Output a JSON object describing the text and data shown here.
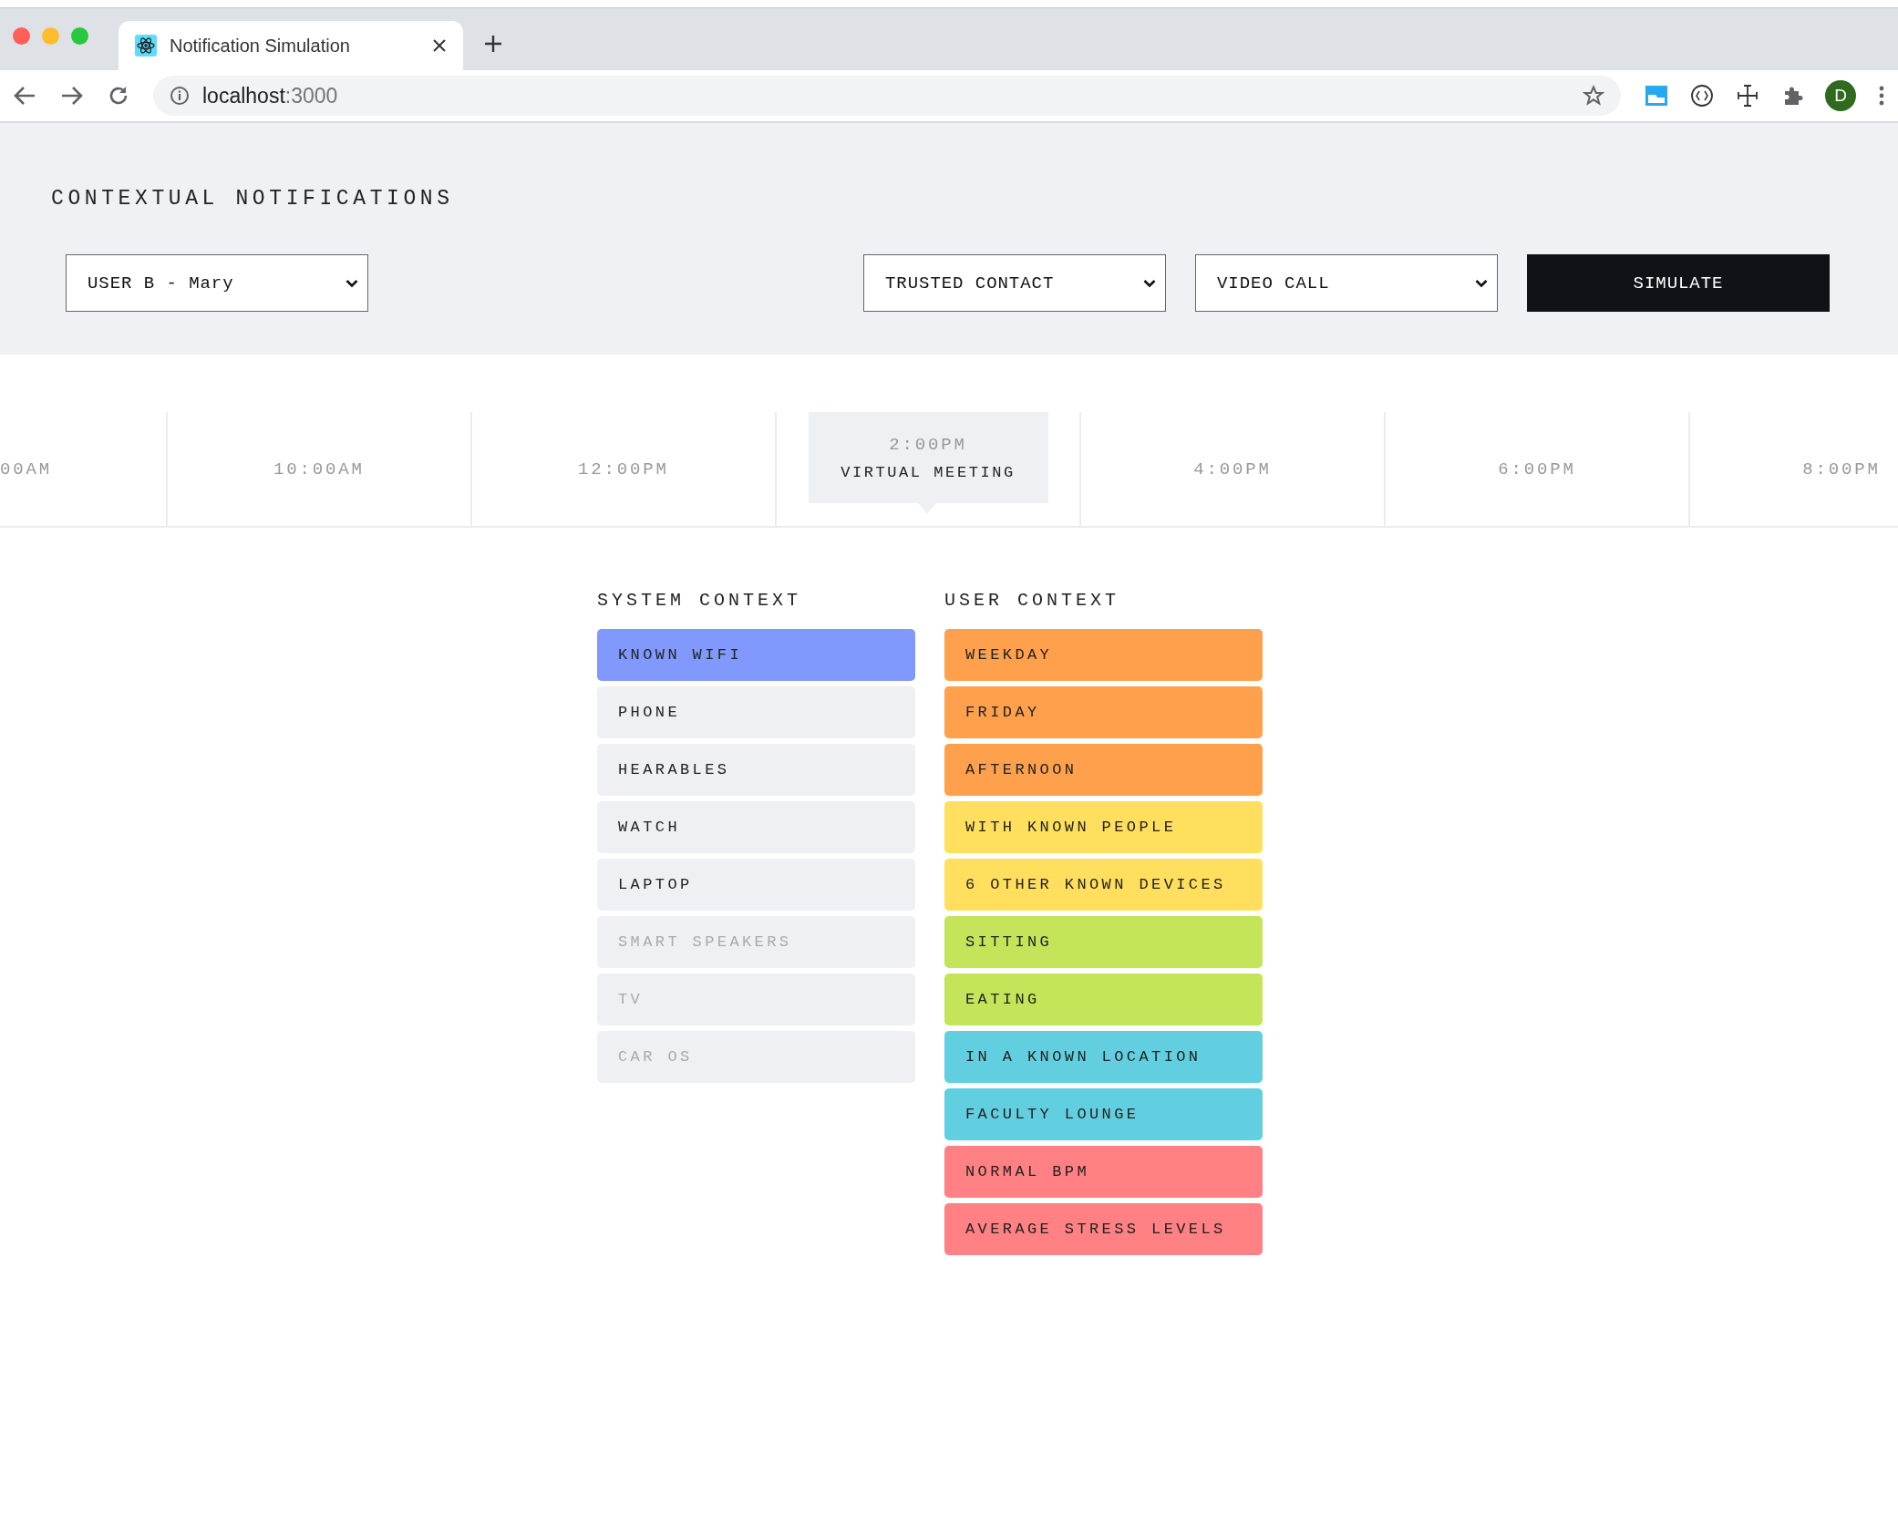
{
  "browser": {
    "tab": {
      "title": "Notification Simulation"
    },
    "url": {
      "host": "localhost",
      "port": ":3000"
    },
    "profile": "D"
  },
  "page": {
    "title": "CONTEXTUAL NOTIFICATIONS",
    "user_select": "USER B - Mary",
    "contact_select": "TRUSTED CONTACT",
    "event_select": "VIDEO CALL",
    "simulate": "SIMULATE",
    "timeline": [
      {
        "time": "00AM",
        "selected": false
      },
      {
        "time": "10:00AM",
        "selected": false
      },
      {
        "time": "12:00PM",
        "selected": false
      },
      {
        "time": "2:00PM",
        "label": "VIRTUAL MEETING",
        "selected": true
      },
      {
        "time": "4:00PM",
        "selected": false
      },
      {
        "time": "6:00PM",
        "selected": false
      },
      {
        "time": "8:00PM",
        "selected": false
      }
    ],
    "system_context": {
      "title": "SYSTEM CONTEXT",
      "items": [
        {
          "label": "KNOWN WIFI",
          "selected": true,
          "disabled": false
        },
        {
          "label": "PHONE",
          "selected": false,
          "disabled": false
        },
        {
          "label": "HEARABLES",
          "selected": false,
          "disabled": false
        },
        {
          "label": "WATCH",
          "selected": false,
          "disabled": false
        },
        {
          "label": "LAPTOP",
          "selected": false,
          "disabled": false
        },
        {
          "label": "SMART SPEAKERS",
          "selected": false,
          "disabled": true
        },
        {
          "label": "TV",
          "selected": false,
          "disabled": true
        },
        {
          "label": "CAR OS",
          "selected": false,
          "disabled": true
        }
      ]
    },
    "user_context": {
      "title": "USER CONTEXT",
      "items": [
        {
          "label": "WEEKDAY",
          "color": "#ffa04c"
        },
        {
          "label": "FRIDAY",
          "color": "#ffa04c"
        },
        {
          "label": "AFTERNOON",
          "color": "#ffa04c"
        },
        {
          "label": "WITH KNOWN PEOPLE",
          "color": "#ffdf5d"
        },
        {
          "label": "6 OTHER KNOWN DEVICES",
          "color": "#ffdf5d"
        },
        {
          "label": "SITTING",
          "color": "#c4e55a"
        },
        {
          "label": "EATING",
          "color": "#c4e55a"
        },
        {
          "label": "IN A KNOWN LOCATION",
          "color": "#62cfe1"
        },
        {
          "label": "FACULTY LOUNGE",
          "color": "#62cfe1"
        },
        {
          "label": "NORMAL BPM",
          "color": "#ff8183"
        },
        {
          "label": "AVERAGE STRESS LEVELS",
          "color": "#ff8183"
        }
      ]
    }
  }
}
